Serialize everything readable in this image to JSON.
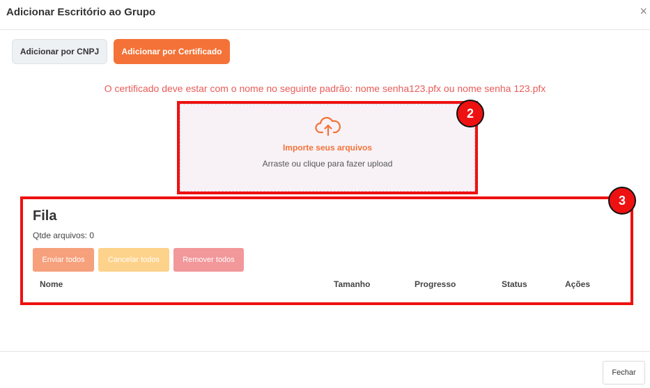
{
  "modal": {
    "title": "Adicionar Escritório ao Grupo",
    "close_glyph": "×"
  },
  "tabs": {
    "cnpj_label": "Adicionar por CNPJ",
    "cert_label": "Adicionar por Certificado"
  },
  "certificate_message": "O certificado deve estar com o nome no seguinte padrão: nome senha123.pfx ou nome senha 123.pfx",
  "dropzone": {
    "icon": "cloud-upload-icon",
    "title": "Importe seus arquivos",
    "subtitle": "Arraste ou clique para fazer upload"
  },
  "annotations": {
    "badge_2": "2",
    "badge_3": "3"
  },
  "queue": {
    "title": "Fila",
    "count_label": "Qtde arquivos: 0",
    "buttons": {
      "send_all": "Enviar todos",
      "cancel_all": "Cancelar todos",
      "remove_all": "Remover todos"
    },
    "columns": [
      "Nome",
      "Tamanho",
      "Progresso",
      "Status",
      "Ações"
    ]
  },
  "footer": {
    "close_label": "Fechar"
  },
  "colors": {
    "accent": "#f47237",
    "warning_text": "#e85b58",
    "highlight": "#ee1111"
  }
}
